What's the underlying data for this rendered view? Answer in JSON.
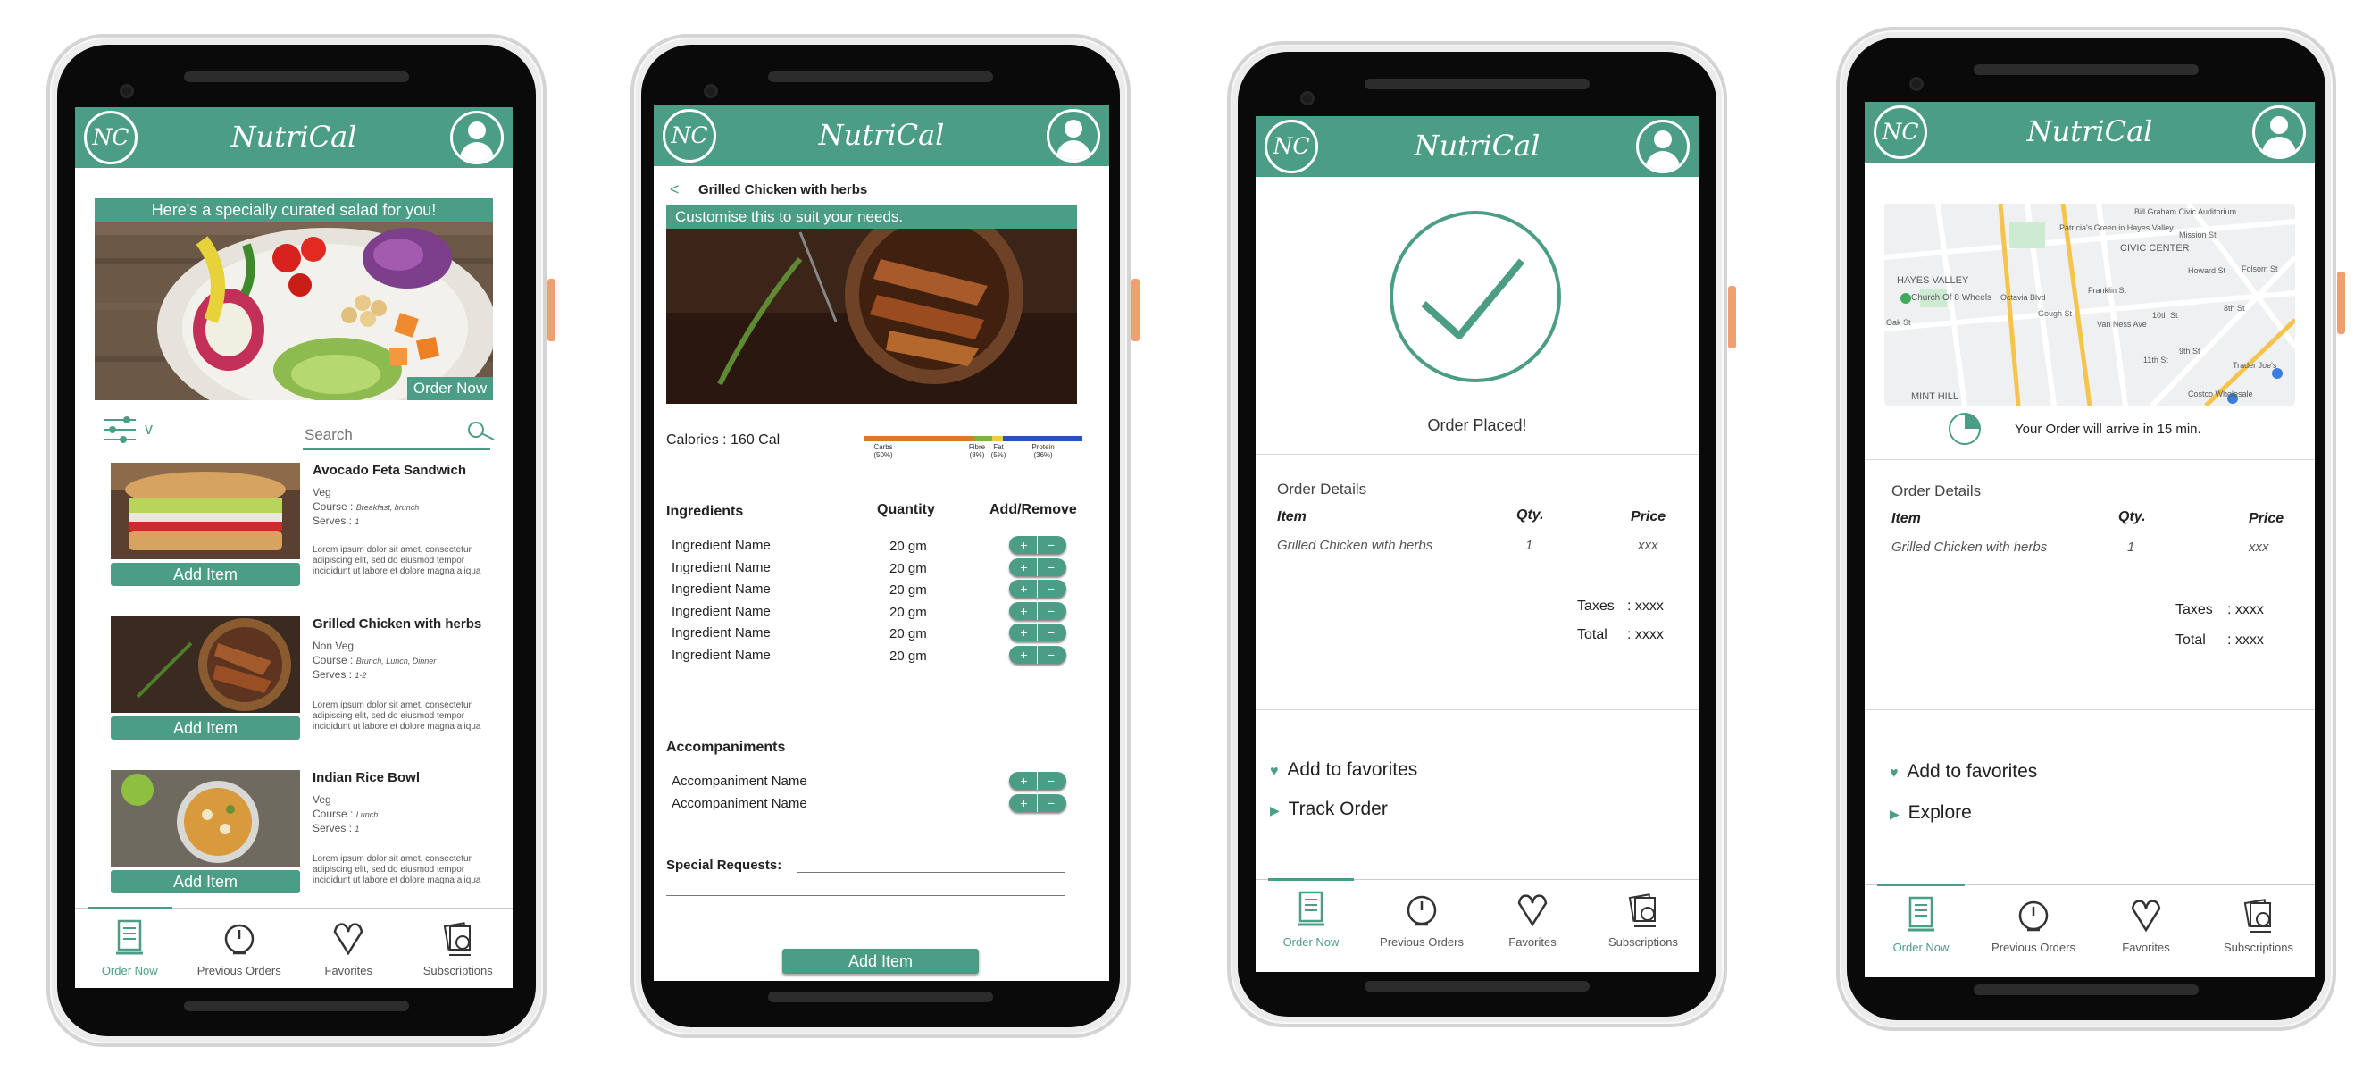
{
  "colors": {
    "brand": "#4c9d85",
    "carbs": "#d97a2b",
    "fibre": "#7cb342",
    "fat": "#f2c94c",
    "protein": "#2a52be"
  },
  "app": {
    "logo_text": "NC",
    "brand": "NutriCal"
  },
  "tabs": [
    {
      "label": "Order Now",
      "icon": "menu-list-icon"
    },
    {
      "label": "Previous Orders",
      "icon": "clock-icon"
    },
    {
      "label": "Favorites",
      "icon": "heart-icon"
    },
    {
      "label": "Subscriptions",
      "icon": "subscriptions-icon"
    }
  ],
  "home": {
    "banner_title": "Here's a specially curated salad for you!",
    "order_now": "Order Now",
    "filter_arrow": "v",
    "search_placeholder": "Search",
    "items": [
      {
        "name": "Avocado Feta Sandwich",
        "diet": "Veg",
        "course_label": "Course :",
        "course": "Breakfast, brunch",
        "serves_label": "Serves :",
        "serves": "1",
        "desc": "Lorem ipsum dolor sit amet, consectetur adipiscing elit, sed do eiusmod tempor incididunt ut labore et dolore magna aliqua",
        "button": "Add Item"
      },
      {
        "name": "Grilled Chicken with herbs",
        "diet": "Non Veg",
        "course_label": "Course :",
        "course": "Brunch, Lunch, Dinner",
        "serves_label": "Serves :",
        "serves": "1-2",
        "desc": "Lorem ipsum dolor sit amet, consectetur adipiscing elit, sed do eiusmod tempor incididunt ut labore et dolore magna aliqua",
        "button": "Add Item"
      },
      {
        "name": "Indian Rice Bowl",
        "diet": "Veg",
        "course_label": "Course :",
        "course": "Lunch",
        "serves_label": "Serves :",
        "serves": "1",
        "desc": "Lorem ipsum dolor sit amet, consectetur adipiscing elit, sed do eiusmod tempor incididunt ut labore et dolore magna aliqua",
        "button": "Add Item"
      }
    ]
  },
  "detail": {
    "back": "<",
    "title": "Grilled Chicken with herbs",
    "customise": "Customise this to suit your needs.",
    "calories": "Calories : 160 Cal",
    "macros": [
      {
        "label": "Carbs",
        "pct": "(50%)",
        "share": 50
      },
      {
        "label": "Fibre",
        "pct": "(8%)",
        "share": 8
      },
      {
        "label": "Fat",
        "pct": "(5%)",
        "share": 5
      },
      {
        "label": "Protein",
        "pct": "(36%)",
        "share": 36
      }
    ],
    "headers": {
      "ingredients": "Ingredients",
      "quantity": "Quantity",
      "addremove": "Add/Remove"
    },
    "ingredients": [
      {
        "name": "Ingredient Name",
        "qty": "20 gm"
      },
      {
        "name": "Ingredient Name",
        "qty": "20 gm"
      },
      {
        "name": "Ingredient Name",
        "qty": "20 gm"
      },
      {
        "name": "Ingredient Name",
        "qty": "20 gm"
      },
      {
        "name": "Ingredient Name",
        "qty": "20 gm"
      },
      {
        "name": "Ingredient Name",
        "qty": "20 gm"
      }
    ],
    "plus": "+",
    "minus": "−",
    "accompaniments_title": "Accompaniments",
    "accompaniments": [
      {
        "name": "Accompaniment Name"
      },
      {
        "name": "Accompaniment Name"
      }
    ],
    "special_requests": "Special Requests:",
    "add_item": "Add Item"
  },
  "confirm": {
    "status": "Order Placed!",
    "details_title": "Order Details",
    "col_item": "Item",
    "col_qty": "Qty.",
    "col_price": "Price",
    "item": "Grilled Chicken with herbs",
    "qty": "1",
    "price": "xxx",
    "taxes_label": "Taxes",
    "taxes": ": xxxx",
    "total_label": "Total",
    "total": ": xxxx",
    "action1": "Add to favorites",
    "action2": "Track Order"
  },
  "tracking": {
    "map_labels": [
      "Bill Graham Civic Auditorium",
      "Patricia's Green in Hayes Valley",
      "CIVIC CENTER",
      "HAYES VALLEY",
      "Church Of 8 Wheels",
      "Oak St",
      "Octavia Blvd",
      "Gough St",
      "Franklin St",
      "Van Ness Ave",
      "Mission St",
      "Howard St",
      "Folsom St",
      "10th St",
      "9th St",
      "8th St",
      "11th St",
      "Trader Joe's",
      "MINT HILL",
      "Costco Wholesale"
    ],
    "arrival": "Your Order will arrive in 15 min.",
    "progress_fraction": 0.25,
    "details_title": "Order Details",
    "col_item": "Item",
    "col_qty": "Qty.",
    "col_price": "Price",
    "item": "Grilled Chicken with herbs",
    "qty": "1",
    "price": "xxx",
    "taxes_label": "Taxes",
    "taxes": ": xxxx",
    "total_label": "Total",
    "total": ": xxxx",
    "action1": "Add to favorites",
    "action2": "Explore"
  }
}
